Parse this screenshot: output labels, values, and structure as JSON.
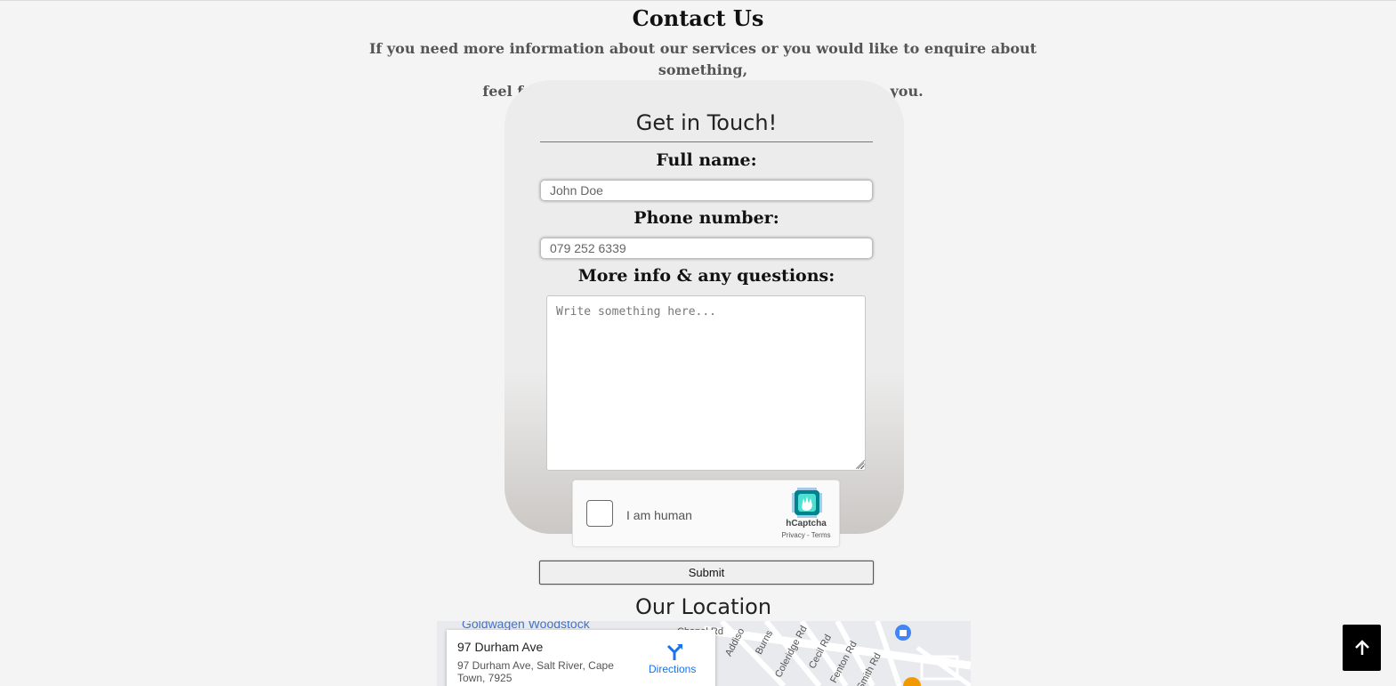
{
  "header": {
    "title": "Contact Us",
    "intro_line1": "If you need more information about our services or you would like to enquire about something,",
    "intro_line2": "feel free to leave your details and we'll get back to you."
  },
  "form": {
    "heading": "Get in Touch!",
    "full_name_label": "Full name:",
    "full_name_placeholder": "John Doe",
    "phone_label": "Phone number:",
    "phone_placeholder": "079 252 6339",
    "message_label": "More info & any questions:",
    "message_placeholder": "Write something here...",
    "submit_label": "Submit"
  },
  "captcha": {
    "label": "I am human",
    "brand": "hCaptcha",
    "links": "Privacy - Terms"
  },
  "location": {
    "title": "Our Location",
    "place_name": "97 Durham Ave",
    "place_address": "97 Durham Ave, Salt River, Cape Town, 7925",
    "directions_label": "Directions",
    "poi_top": "Goldwagen Woodstock",
    "streets": [
      "Addiso",
      "Burns",
      "Coleridge Rd",
      "Cecil Rd",
      "Fenton Rd",
      "Smith Rd",
      "Chapel Rd"
    ]
  },
  "colors": {
    "page_bg": "#f4f4f4",
    "card_top": "#ececec",
    "card_bottom": "#cbc8c5",
    "link_blue": "#1a73e8",
    "back_to_top_bg": "#000000"
  },
  "icons": {
    "back_to_top": "arrow-up-icon",
    "directions": "directions-icon",
    "captcha_logo": "hcaptcha-logo-icon",
    "map_pin": "shopping-pin-icon"
  }
}
